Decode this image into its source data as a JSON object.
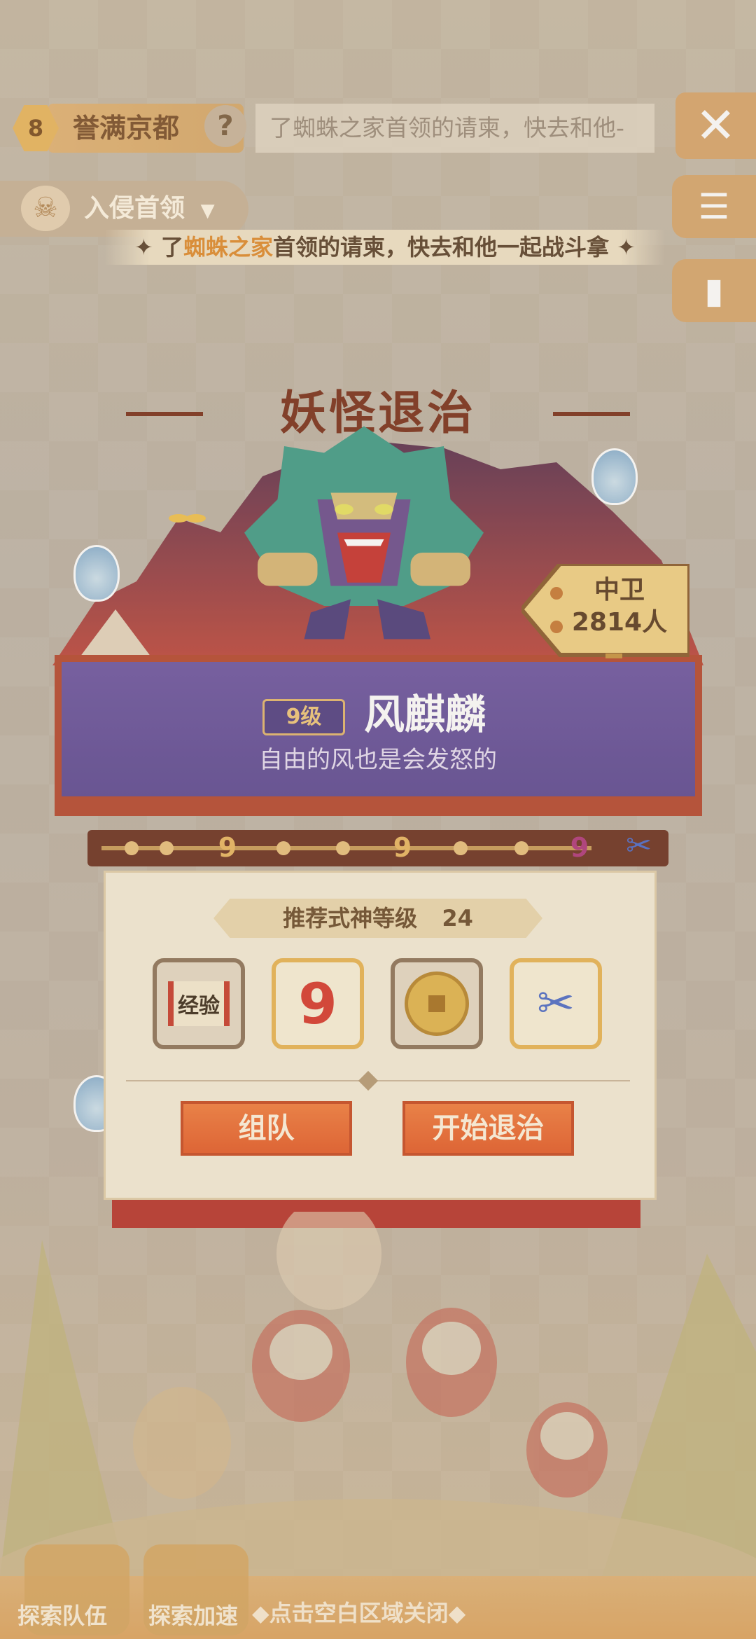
{
  "top": {
    "area_level": "8",
    "area_name": "誉满京都",
    "help": "?",
    "ticker_faded": "了蜘蛛之家首领的请柬，快去和他-",
    "close_icon": "x-close-icon"
  },
  "invade": {
    "label": "入侵首领",
    "arrow": "▼"
  },
  "ticker": {
    "pre": "了",
    "highlight": "蜘蛛之家",
    "post": "首领的请柬，快去和他一起战斗拿"
  },
  "side_buttons": [
    "scroll-list-icon",
    "card-icon"
  ],
  "event": {
    "title": "妖怪退治"
  },
  "boss": {
    "level": "9级",
    "name": "风麒麟",
    "desc": "自由的风也是会发怒的"
  },
  "location": {
    "name": "中卫",
    "count": "2814人"
  },
  "progress": {
    "milestones": [
      "9",
      "9",
      "9"
    ]
  },
  "recommend": {
    "label": "推荐式神等级",
    "value": "24"
  },
  "rewards": [
    {
      "name": "经验",
      "icon": "exp-scroll-icon",
      "frame": "brown"
    },
    {
      "name": "",
      "icon": "red-nine-token-icon",
      "frame": "gold"
    },
    {
      "name": "",
      "icon": "gold-coin-icon",
      "frame": "brown"
    },
    {
      "name": "",
      "icon": "scissor-token-icon",
      "frame": "gold"
    }
  ],
  "buttons": {
    "team": "组队",
    "start": "开始退治"
  },
  "bottom": {
    "explore_team": "探索队伍",
    "explore_speed": "探索加速",
    "hint": "◆点击空白区域关闭◆"
  },
  "colors": {
    "accent_orange": "#e55a26",
    "purple_panel": "#5c4792",
    "title_red": "#7a2e18"
  }
}
